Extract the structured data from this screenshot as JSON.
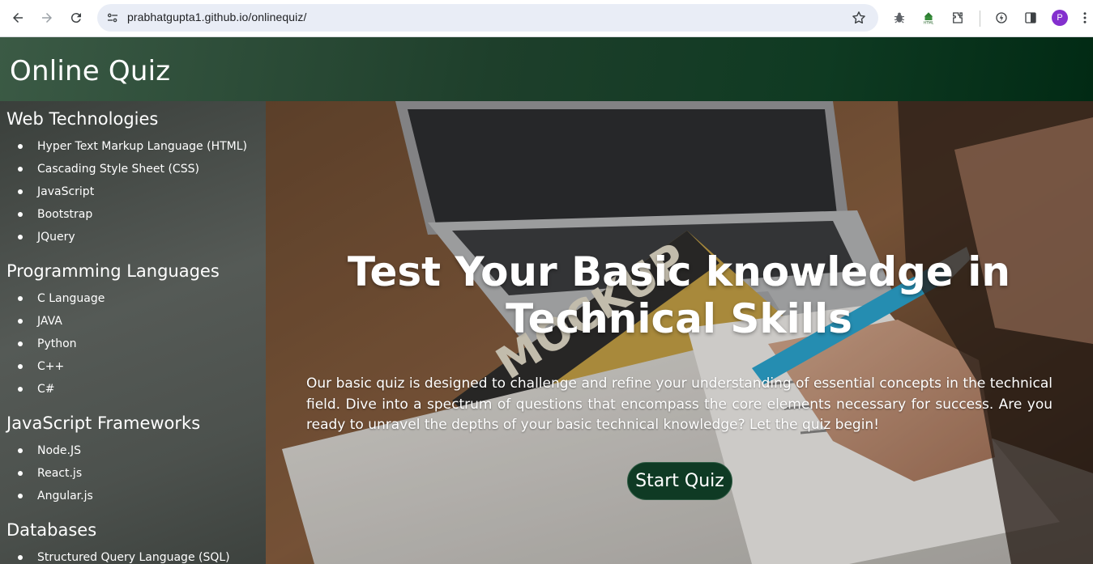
{
  "browser": {
    "url": "prabhatgupta1.github.io/onlinequiz/",
    "avatar_letter": "P",
    "accent_color": "#8430ce"
  },
  "header": {
    "title": "Online Quiz",
    "gradient_colors": [
      "#3b5a45",
      "#012a14"
    ]
  },
  "sidebar": {
    "sections": [
      {
        "title": "Web Technologies",
        "items": [
          "Hyper Text Markup Language (HTML)",
          "Cascading Style Sheet (CSS)",
          "JavaScript",
          "Bootstrap",
          "JQuery"
        ]
      },
      {
        "title": "Programming Languages",
        "items": [
          "C Language",
          "JAVA",
          "Python",
          "C++",
          "C#"
        ]
      },
      {
        "title": "JavaScript Frameworks",
        "items": [
          "Node.JS",
          "React.js",
          "Angular.js"
        ]
      },
      {
        "title": "Databases",
        "items": [
          "Structured Query Language (SQL)"
        ]
      }
    ]
  },
  "hero": {
    "title": "Test Your Basic knowledge in Technical Skills",
    "description": "Our basic quiz is designed to challenge and refine your understanding of essential concepts in the technical field. Dive into a spectrum of questions that encompass the core elements necessary for success. Are you ready to unravel the depths of your basic technical knowledge? Let the quiz begin!",
    "button_label": "Start Quiz",
    "button_color": "#0f3a24"
  }
}
